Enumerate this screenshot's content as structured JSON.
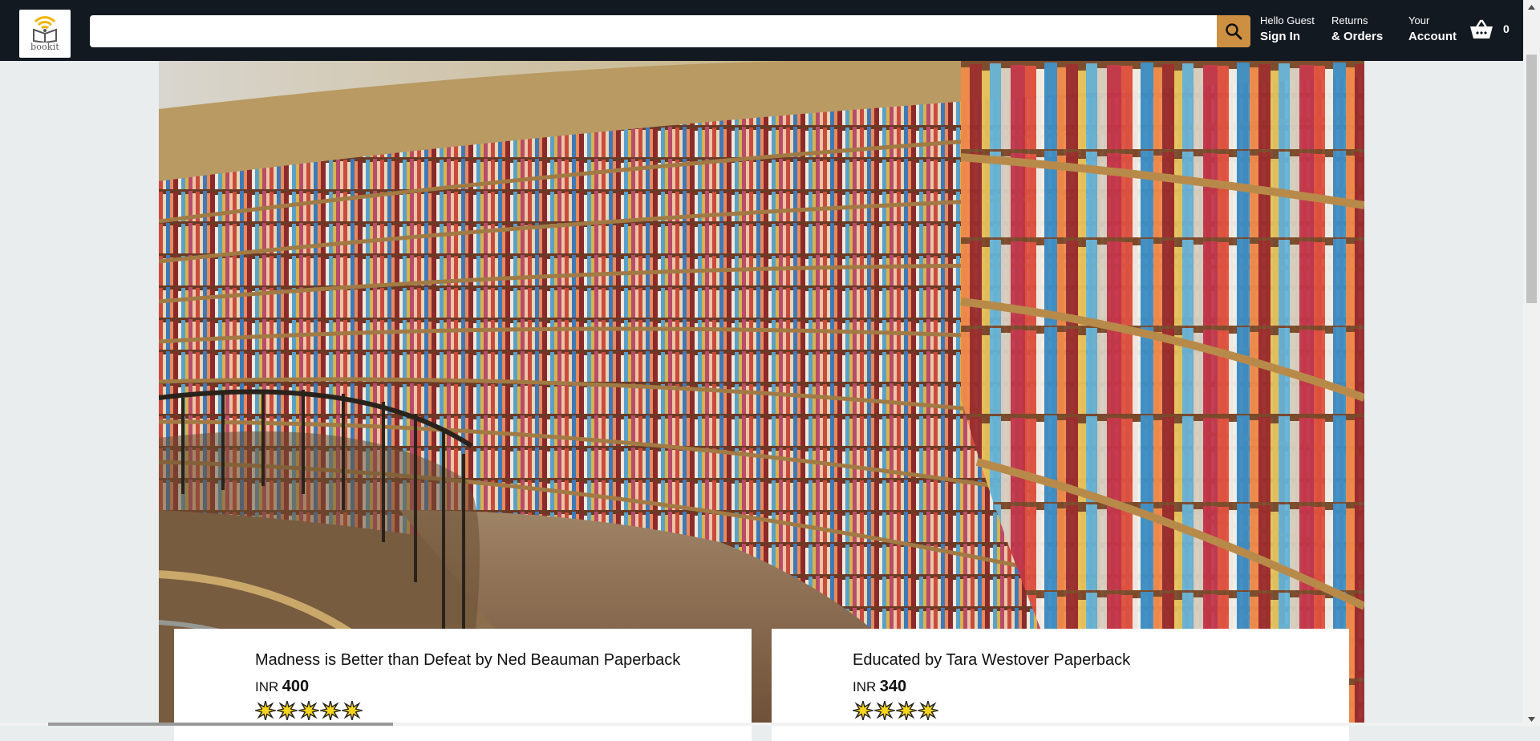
{
  "header": {
    "logo_text": "bookit",
    "search": {
      "value": "",
      "placeholder": ""
    },
    "signin": {
      "line1": "Hello Guest",
      "line2": "Sign In"
    },
    "orders": {
      "line1": "Returns",
      "line2": "& Orders"
    },
    "account": {
      "line1": "Your",
      "line2": "Account"
    },
    "basket_count": "0"
  },
  "products": [
    {
      "title": "Madness is Better than Defeat by Ned Beauman Paperback",
      "currency": "INR",
      "price": "400",
      "rating": 5
    },
    {
      "title": "Educated by Tara Westover Paperback",
      "currency": "INR",
      "price": "340",
      "rating": 4
    }
  ],
  "colors": {
    "header_bg": "#131921",
    "search_button": "#cd9042",
    "page_bg": "#eaeded",
    "logo_accent": "#f0b400"
  },
  "icons": {
    "logo": "book-wifi-logo-icon",
    "search": "search-icon",
    "basket": "basket-icon",
    "star": "star-icon"
  }
}
